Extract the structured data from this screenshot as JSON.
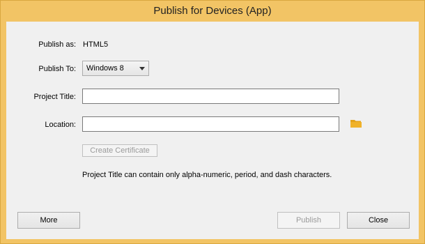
{
  "window": {
    "title": "Publish for Devices (App)"
  },
  "form": {
    "publish_as_label": "Publish as:",
    "publish_as_value": "HTML5",
    "publish_to_label": "Publish To:",
    "publish_to_selected": "Windows 8",
    "project_title_label": "Project Title:",
    "project_title_value": "",
    "location_label": "Location:",
    "location_value": "",
    "folder_icon": "folder-icon",
    "create_certificate_label": "Create Certificate",
    "hint": "Project Title can contain only alpha-numeric, period, and dash characters."
  },
  "buttons": {
    "more": "More",
    "publish": "Publish",
    "close": "Close"
  },
  "colors": {
    "title_bar": "#f2c465",
    "folder": "#e3a21a"
  }
}
